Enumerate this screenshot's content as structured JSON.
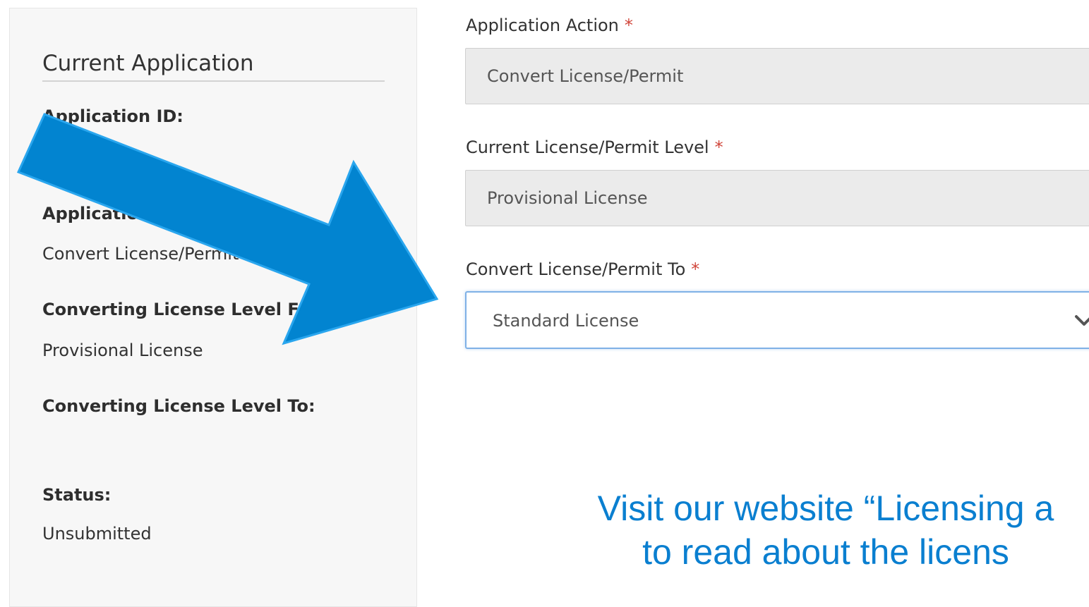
{
  "sidebar": {
    "title": "Current Application",
    "application_id_label": "Application ID:",
    "application_label": "Application",
    "application_value": "Convert License/Permit",
    "converting_from_label": "Converting License Level From:",
    "converting_from_value": "Provisional License",
    "converting_to_label": "Converting License Level To:",
    "status_label": "Status:",
    "status_value": "Unsubmitted"
  },
  "form": {
    "required_mark": "*",
    "application_action": {
      "label": "Application Action",
      "value": "Convert License/Permit"
    },
    "current_level": {
      "label": "Current License/Permit Level",
      "value": "Provisional License"
    },
    "convert_to": {
      "label": "Convert License/Permit To",
      "value": "Standard License"
    }
  },
  "promo": {
    "line1": "Visit our website “Licensing a",
    "line2": "to read about the licens"
  },
  "colors": {
    "arrow": "#0284d0",
    "promo_text": "#0a7fd0",
    "required": "#d0453a",
    "focus_border": "#7fb1e6"
  },
  "icons": {
    "select_toggle": "chevron-down-icon",
    "annotation": "arrow-right-icon"
  }
}
